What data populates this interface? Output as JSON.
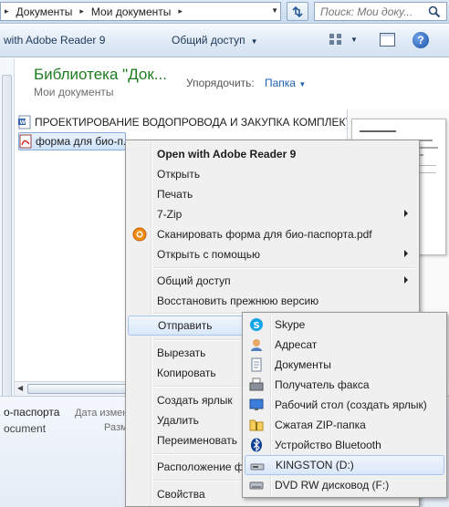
{
  "address_bar": {
    "crumbs": [
      "Документы",
      "Мои документы"
    ],
    "search_placeholder": "Поиск: Мои доку..."
  },
  "toolbar": {
    "open_with": "with Adobe Reader 9",
    "share": "Общий доступ"
  },
  "library": {
    "title": "Библиотека \"Док...",
    "subtitle": "Мои документы",
    "arrange_label": "Упорядочить:",
    "arrange_value": "Папка"
  },
  "files": [
    {
      "name": "ПРОЕКТИРОВАНИЕ ВОДОПРОВОДА И ЗАКУПКА КОМПЛЕКТ",
      "icon": "word-doc-icon"
    },
    {
      "name": "форма для био-п...",
      "icon": "pdf-icon"
    }
  ],
  "details": {
    "name": "о-паспорта",
    "modified_label": "Дата изменен",
    "type": "ocument",
    "size_label": "Разм"
  },
  "context_menu": {
    "items": [
      {
        "label": "Open with Adobe Reader 9",
        "bold": true
      },
      {
        "label": "Открыть"
      },
      {
        "label": "Печать"
      },
      {
        "label": "7-Zip",
        "submenu": true
      },
      {
        "label": "Сканировать форма для био-паспорта.pdf",
        "icon": "antivirus-icon"
      },
      {
        "label": "Открыть с помощью",
        "submenu": true
      },
      {
        "label": "Общий доступ",
        "submenu": true
      },
      {
        "label": "Восстановить прежнюю версию"
      },
      {
        "label": "Отправить",
        "submenu": true,
        "highlighted": true
      },
      {
        "label": "Вырезать"
      },
      {
        "label": "Копировать"
      },
      {
        "label": "Создать ярлык"
      },
      {
        "label": "Удалить"
      },
      {
        "label": "Переименовать"
      },
      {
        "label": "Расположение ф"
      },
      {
        "label": "Свойства"
      }
    ]
  },
  "send_to_menu": {
    "items": [
      {
        "label": "Skype",
        "icon": "skype-icon"
      },
      {
        "label": "Адресат",
        "icon": "contact-icon"
      },
      {
        "label": "Документы",
        "icon": "documents-icon"
      },
      {
        "label": "Получатель факса",
        "icon": "fax-icon"
      },
      {
        "label": "Рабочий стол (создать ярлык)",
        "icon": "desktop-icon"
      },
      {
        "label": "Сжатая ZIP-папка",
        "icon": "zip-folder-icon"
      },
      {
        "label": "Устройство Bluetooth",
        "icon": "bluetooth-icon"
      },
      {
        "label": "KINGSTON (D:)",
        "icon": "usb-drive-icon",
        "highlighted": true
      },
      {
        "label": "DVD RW дисковод (F:)",
        "icon": "dvd-drive-icon"
      }
    ]
  },
  "colors": {
    "library_title": "#1e7b1e",
    "link": "#1e5fb4",
    "menu_bg": "#f0f0f0",
    "highlight_border": "#a8c5ec"
  }
}
